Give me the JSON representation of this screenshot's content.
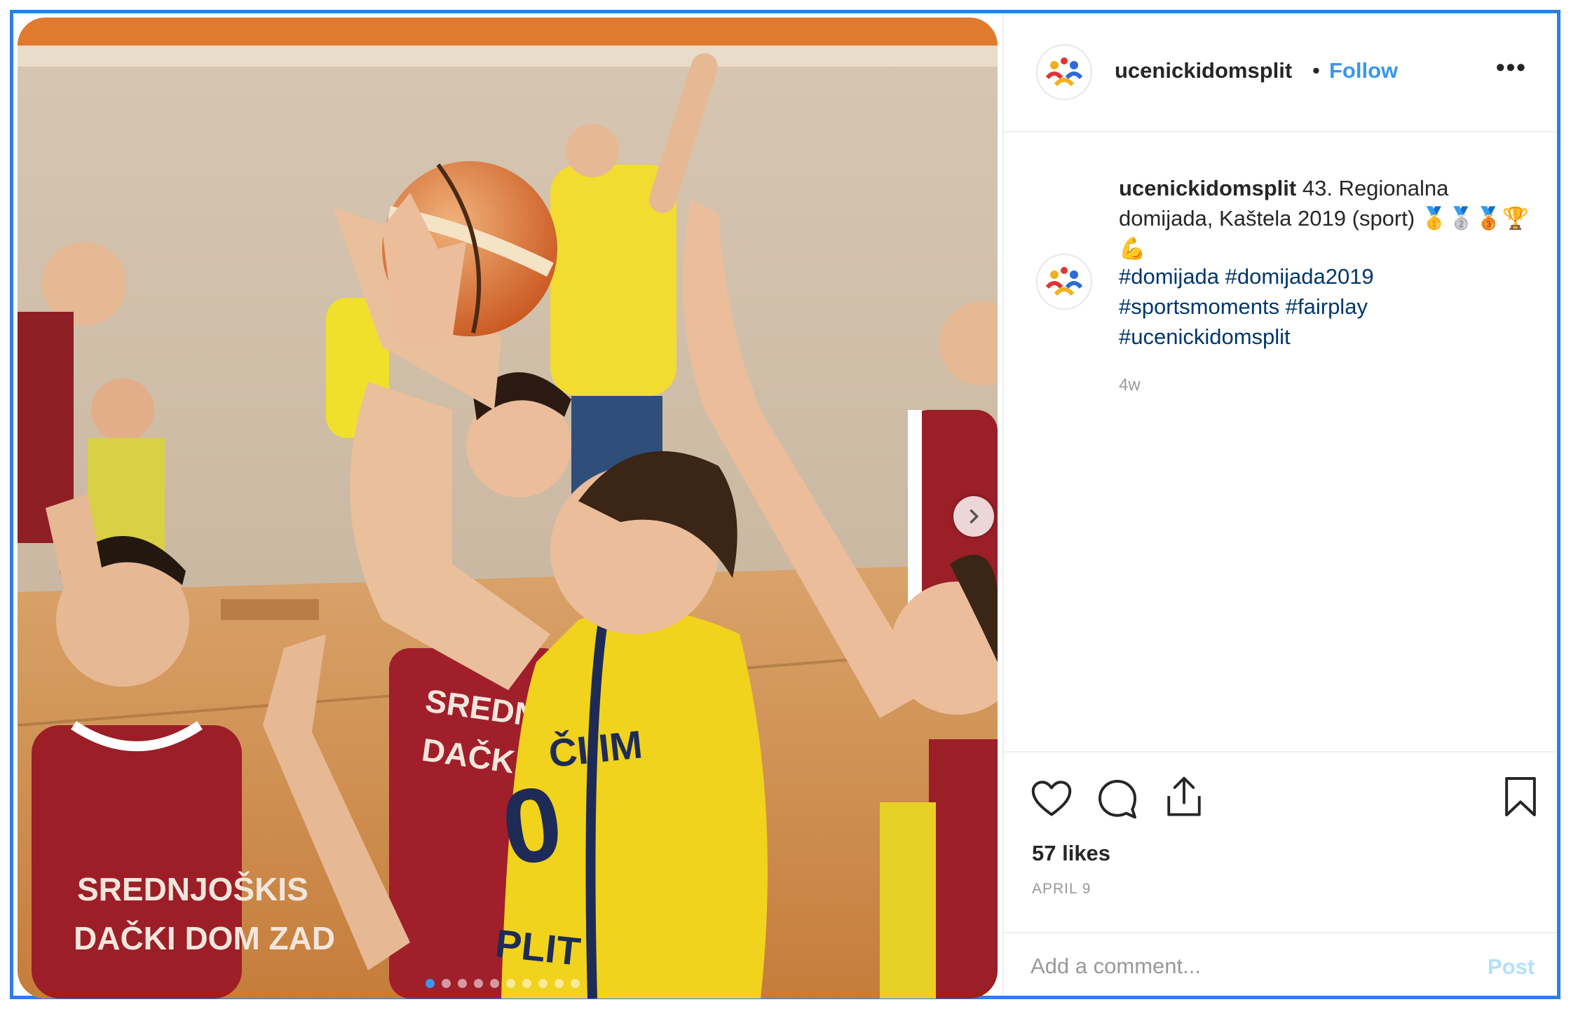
{
  "post": {
    "username": "ucenickidomsplit",
    "separator": "•",
    "follow_label": "Follow",
    "more_label": "•••",
    "caption_user": "ucenickidomsplit",
    "caption_text": " 43. Regionalna domijada, Kaštela 2019 (sport) 🥇🥈🥉🏆💪",
    "hashtags": [
      "#domijada",
      "#domijada2019",
      "#sportsmoments",
      "#fairplay",
      "#ucenickidomsplit"
    ],
    "time_ago": "4w",
    "likes": "57 likes",
    "date": "APRIL 9",
    "comment_placeholder": "Add a comment...",
    "post_label": "Post",
    "carousel": {
      "count": 10,
      "active_index": 0
    }
  },
  "colors": {
    "accent": "#3897f0",
    "frame": "#2d7fe0",
    "hashtag": "#00376b",
    "muted": "#999999"
  },
  "icons": [
    "next-arrow-icon",
    "heart-icon",
    "comment-icon",
    "share-icon",
    "bookmark-icon",
    "more-icon",
    "avatar-logo-icon"
  ],
  "photo": {
    "jersey_text_red": "SREDNJOŠKOLSKI DAČKI DOM ZADAR",
    "jersey_text_yellow": "UČENIČKI DOM SPLIT"
  }
}
